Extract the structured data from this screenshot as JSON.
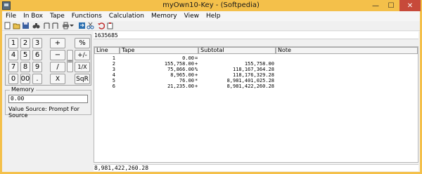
{
  "window": {
    "title": "myOwn10-Key - (Softpedia)",
    "minimize": "—",
    "maximize": "☐",
    "close": "✕"
  },
  "menu": [
    "File",
    "In Box",
    "Tape",
    "Functions",
    "Calculation",
    "Memory",
    "View",
    "Help"
  ],
  "toolbar": {
    "icons": [
      "new-icon",
      "open-icon",
      "save-icon",
      "binoculars-icon",
      "column-icon",
      "column-icon",
      "print-icon",
      "dropdown-arrow-icon",
      "export-icon",
      "scissors-icon",
      "undo-icon",
      "clipboard-icon"
    ]
  },
  "keypad": {
    "digits": [
      "1",
      "2",
      "3",
      "4",
      "5",
      "6",
      "7",
      "8",
      "9",
      "0",
      "00",
      "."
    ],
    "operators": [
      "+",
      "%",
      "−",
      "+/-",
      "=",
      "/",
      "1/X",
      "X",
      "SqR"
    ]
  },
  "memory": {
    "label": "Memory",
    "value": "0.00",
    "value_source": "Value Source:  Prompt For Source"
  },
  "entry_display": "1635685",
  "tape": {
    "columns": [
      "Line",
      "Tape",
      "Subtotal",
      "Note"
    ],
    "rows": [
      {
        "line": "1",
        "tape": "0.00",
        "op": "=",
        "subtotal": ""
      },
      {
        "line": "2",
        "tape": "155,758.00",
        "op": "+",
        "subtotal": "155,758.00"
      },
      {
        "line": "3",
        "tape": "75,866.00",
        "op": "%",
        "subtotal": "118,167,364.28"
      },
      {
        "line": "4",
        "tape": "8,965.00",
        "op": "+",
        "subtotal": "118,176,329.28"
      },
      {
        "line": "5",
        "tape": "76.00",
        "op": "*",
        "subtotal": "8,981,401,025.28"
      },
      {
        "line": "6",
        "tape": "21,235.00",
        "op": "+",
        "subtotal": "8,981,422,260.28"
      }
    ]
  },
  "result_display": "8,981,422,260.28",
  "colors": {
    "titlebar": "#f4c04a",
    "close_button": "#c74a3a",
    "client_bg": "#f0f0f0"
  }
}
